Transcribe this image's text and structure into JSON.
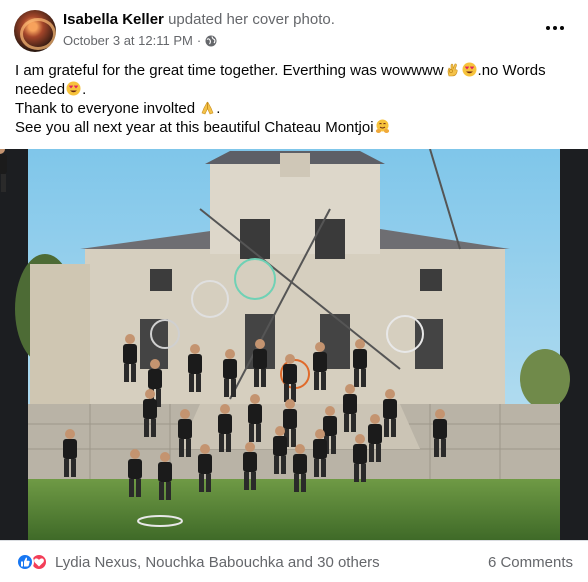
{
  "post": {
    "author": "Isabella Keller",
    "action": "updated her cover photo.",
    "timestamp": "October 3 at 12:11 PM",
    "separator": "·",
    "privacy_icon": "globe-icon",
    "more_icon": "ellipsis-icon",
    "text": {
      "line1_a": "I am grateful for the great time together. Everthing was wowwww",
      "line1_b": ".no Words",
      "line2": "needed",
      "line2_end": ".",
      "line3": "Thank to everyone involted",
      "line3_end": ".",
      "line4": "See you all next year at this beautiful Chateau Montjoi"
    },
    "emojis": [
      "ok-hand-emoji",
      "heart-eyes-emoji",
      "heart-eyes-emoji",
      "folded-hands-emoji",
      "hugging-face-emoji"
    ]
  },
  "photo": {
    "description_icon": "group-photo",
    "colors": {
      "sky": "#9fd3ee",
      "building": "#d8d2c4",
      "grass": "#5e8a3c",
      "shirts": "#1b1b1b"
    }
  },
  "footer": {
    "reaction_icons": [
      "like-icon",
      "love-icon"
    ],
    "reactors_text": "Lydia Nexus, Nouchka Babouchka and 30 others",
    "comments_text": "6 Comments"
  },
  "colors": {
    "secondary_text": "#65676b",
    "like_blue": "#1877f2",
    "love_red": "#f33e58"
  }
}
